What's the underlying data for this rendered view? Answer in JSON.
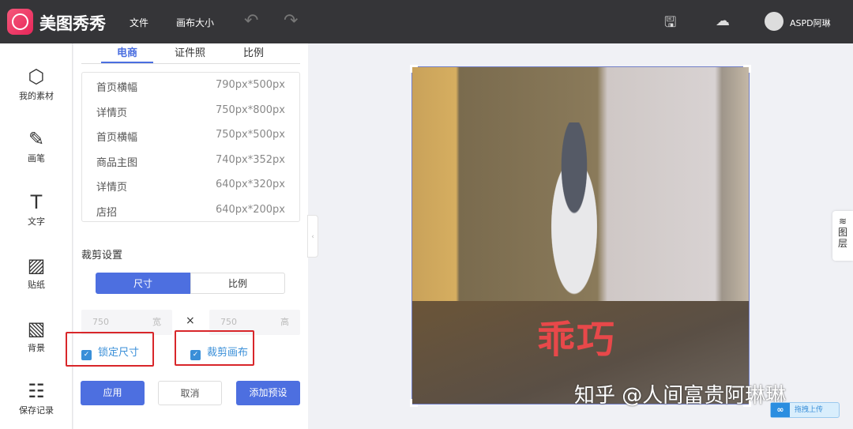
{
  "header": {
    "brand": "美图秀秀",
    "menu": [
      "文件",
      "画布大小"
    ],
    "user": "ASPD阿琳"
  },
  "sidebar": [
    {
      "icon": "⬡",
      "label": "我的素材"
    },
    {
      "icon": "✎",
      "label": "画笔"
    },
    {
      "icon": "T",
      "label": "文字"
    },
    {
      "icon": "▨",
      "label": "贴纸"
    },
    {
      "icon": "▧",
      "label": "背景"
    },
    {
      "icon": "☷",
      "label": "保存记录"
    }
  ],
  "panel": {
    "tabs": [
      "电商",
      "证件照",
      "比例"
    ],
    "presets": [
      {
        "name": "首页横幅",
        "size": "790px*500px"
      },
      {
        "name": "详情页",
        "size": "750px*800px"
      },
      {
        "name": "首页横幅",
        "size": "750px*500px"
      },
      {
        "name": "商品主图",
        "size": "740px*352px"
      },
      {
        "name": "详情页",
        "size": "640px*320px"
      },
      {
        "name": "店招",
        "size": "640px*200px"
      }
    ],
    "crop_title": "裁剪设置",
    "seg": [
      "尺寸",
      "比例"
    ],
    "width": "750",
    "width_label": "宽",
    "times": "×",
    "height": "750",
    "height_label": "高",
    "lock": "锁定尺寸",
    "crop_canvas": "裁剪画布",
    "apply": "应用",
    "cancel": "取消",
    "add_preset": "添加预设"
  },
  "canvas": {
    "caption": "乖巧"
  },
  "watermark": "知乎 @人间富贵阿琳琳",
  "layers": "图层",
  "upload": "拖拽上传"
}
